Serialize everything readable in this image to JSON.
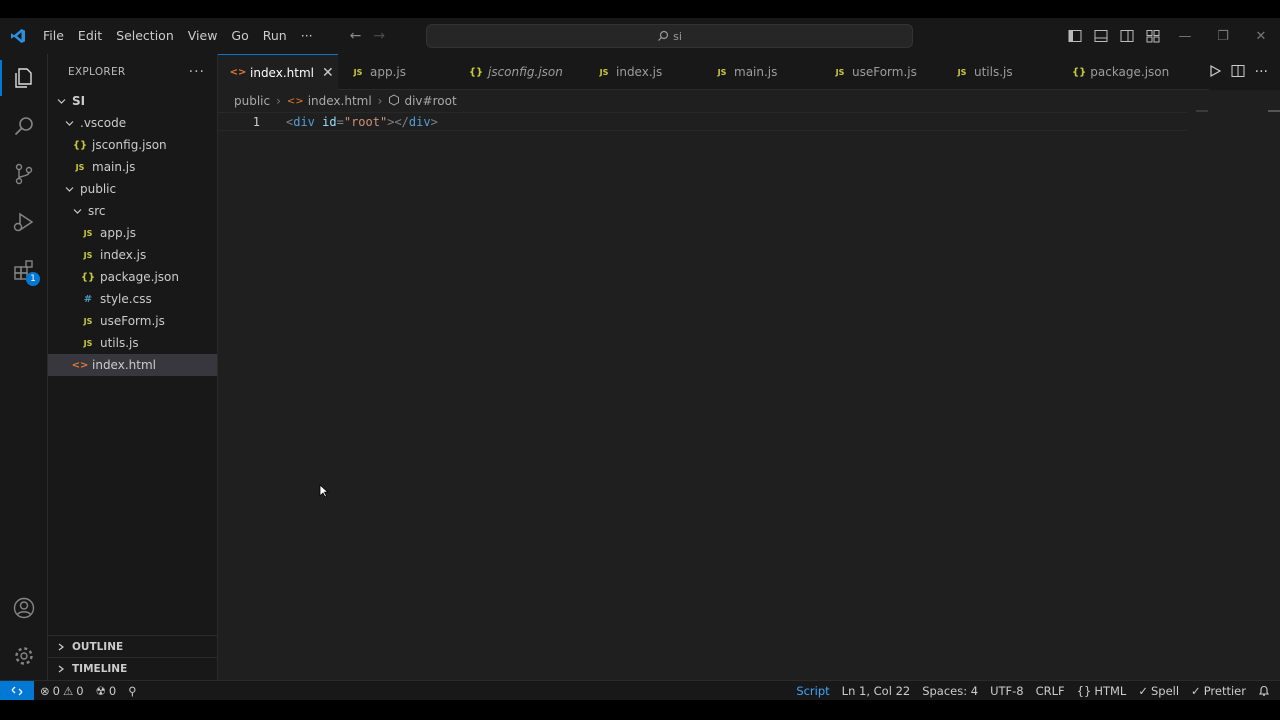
{
  "titlebar": {
    "menu": [
      "File",
      "Edit",
      "Selection",
      "View",
      "Go",
      "Run",
      "···"
    ],
    "search_text": "si"
  },
  "activity": {
    "extensions_badge": "1"
  },
  "sidebar": {
    "title": "EXPLORER",
    "more": "···",
    "tree": [
      {
        "label": "SI",
        "kind": "root",
        "depth": 0,
        "icon": "chevron-down"
      },
      {
        "label": ".vscode",
        "kind": "folder",
        "depth": 1,
        "icon": "chevron-down"
      },
      {
        "label": "jsconfig.json",
        "kind": "json",
        "depth": 2
      },
      {
        "label": "main.js",
        "kind": "js",
        "depth": 2
      },
      {
        "label": "public",
        "kind": "folder",
        "depth": 1,
        "icon": "chevron-down"
      },
      {
        "label": "src",
        "kind": "folder",
        "depth": 2,
        "icon": "chevron-down"
      },
      {
        "label": "app.js",
        "kind": "js",
        "depth": 3
      },
      {
        "label": "index.js",
        "kind": "js",
        "depth": 3
      },
      {
        "label": "package.json",
        "kind": "json",
        "depth": 3
      },
      {
        "label": "style.css",
        "kind": "css",
        "depth": 3
      },
      {
        "label": "useForm.js",
        "kind": "js",
        "depth": 3
      },
      {
        "label": "utils.js",
        "kind": "js",
        "depth": 3
      },
      {
        "label": "index.html",
        "kind": "html",
        "depth": 2,
        "selected": true
      }
    ],
    "outline": "OUTLINE",
    "timeline": "TIMELINE"
  },
  "tabs": [
    {
      "label": "index.html",
      "kind": "html",
      "active": true,
      "close": "✕"
    },
    {
      "label": "app.js",
      "kind": "js"
    },
    {
      "label": "jsconfig.json",
      "kind": "json",
      "italic": true
    },
    {
      "label": "index.js",
      "kind": "js"
    },
    {
      "label": "main.js",
      "kind": "js"
    },
    {
      "label": "useForm.js",
      "kind": "js"
    },
    {
      "label": "utils.js",
      "kind": "js"
    },
    {
      "label": "package.json",
      "kind": "json"
    }
  ],
  "file_icons": {
    "js": "JS",
    "json": "{}",
    "css": "#",
    "html": "<>"
  },
  "editor": {
    "breadcrumb": {
      "folder": "public",
      "file": "index.html",
      "symbol": "div#root"
    },
    "line_number": "1",
    "code": {
      "open_br": "<",
      "tag": "div",
      "attr": " id",
      "eq": "=",
      "value": "\"root\"",
      "close_br": ">",
      "end_open": "</",
      "end_tag": "div",
      "end_close": ">"
    }
  },
  "statusbar": {
    "errors": "0",
    "warnings": "0",
    "ports": "0",
    "language_script": "Script",
    "position": "Ln 1, Col 22",
    "spaces": "Spaces: 4",
    "encoding": "UTF-8",
    "eol": "CRLF",
    "language": "HTML",
    "spell": "Spell",
    "prettier": "Prettier"
  },
  "colors": {
    "accent": "#0078d4",
    "js": "#cbcb41",
    "html": "#e37933",
    "css": "#519aba"
  }
}
